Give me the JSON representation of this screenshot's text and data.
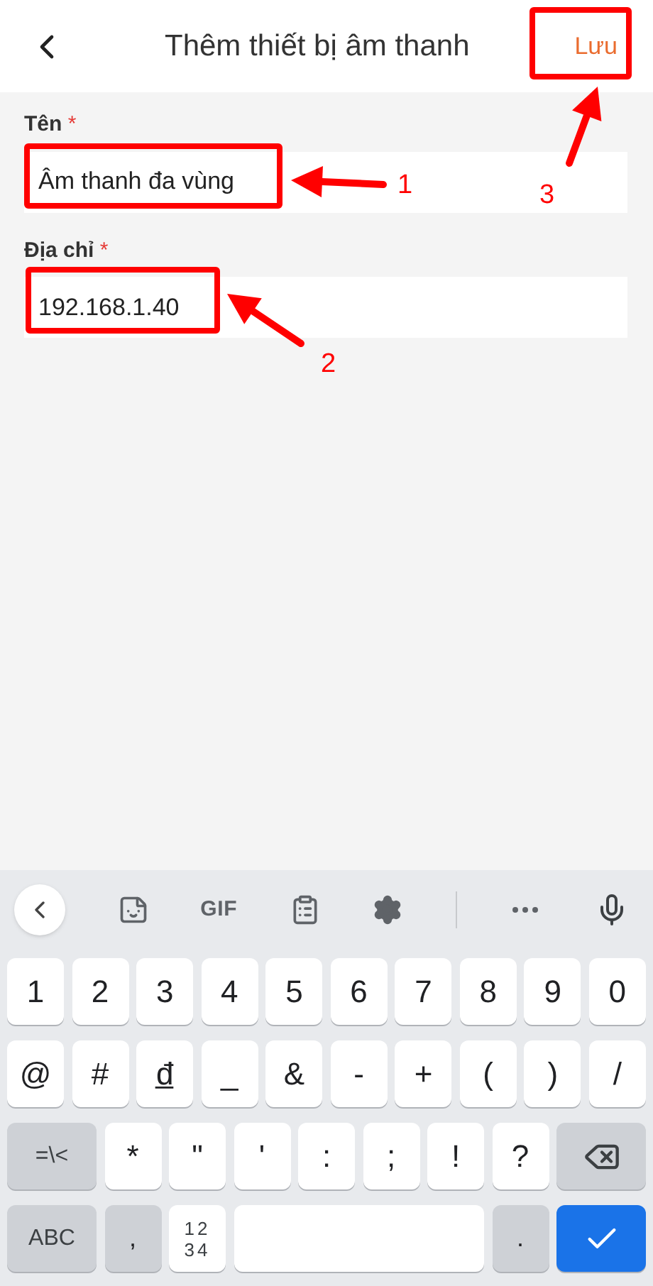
{
  "header": {
    "title": "Thêm thiết bị âm thanh",
    "action": "Lưu"
  },
  "fields": [
    {
      "label": "Tên",
      "required_mark": "*",
      "value": "Âm thanh đa vùng"
    },
    {
      "label": "Địa chỉ",
      "required_mark": "*",
      "value": "192.168.1.40"
    }
  ],
  "keyboard": {
    "toolbar": [
      {
        "kind": "back"
      },
      {
        "kind": "sticker"
      },
      {
        "kind": "text",
        "label": "GIF"
      },
      {
        "kind": "clipboard"
      },
      {
        "kind": "settings"
      },
      {
        "kind": "divider"
      },
      {
        "kind": "more"
      },
      {
        "kind": "mic"
      }
    ],
    "rows": [
      [
        {
          "kind": "char",
          "label": "1"
        },
        {
          "kind": "char",
          "label": "2"
        },
        {
          "kind": "char",
          "label": "3"
        },
        {
          "kind": "char",
          "label": "4"
        },
        {
          "kind": "char",
          "label": "5"
        },
        {
          "kind": "char",
          "label": "6"
        },
        {
          "kind": "char",
          "label": "7"
        },
        {
          "kind": "char",
          "label": "8"
        },
        {
          "kind": "char",
          "label": "9"
        },
        {
          "kind": "char",
          "label": "0"
        }
      ],
      [
        {
          "kind": "char",
          "label": "@"
        },
        {
          "kind": "char",
          "label": "#"
        },
        {
          "kind": "char",
          "label": "đ̲"
        },
        {
          "kind": "char",
          "label": "_"
        },
        {
          "kind": "char",
          "label": "&"
        },
        {
          "kind": "char",
          "label": "-"
        },
        {
          "kind": "char",
          "label": "+"
        },
        {
          "kind": "char",
          "label": "("
        },
        {
          "kind": "char",
          "label": ")"
        },
        {
          "kind": "char",
          "label": "/"
        }
      ],
      [
        {
          "kind": "mode",
          "label": "=\\<"
        },
        {
          "kind": "char",
          "label": "*"
        },
        {
          "kind": "char",
          "label": "\""
        },
        {
          "kind": "char",
          "label": "'"
        },
        {
          "kind": "char",
          "label": ":"
        },
        {
          "kind": "char",
          "label": ";"
        },
        {
          "kind": "char",
          "label": "!"
        },
        {
          "kind": "char",
          "label": "?"
        },
        {
          "kind": "backspace"
        }
      ],
      [
        {
          "kind": "mode",
          "label": "ABC"
        },
        {
          "kind": "gray",
          "label": ","
        },
        {
          "kind": "numpad",
          "lines": [
            "12",
            "34"
          ]
        },
        {
          "kind": "space"
        },
        {
          "kind": "gray",
          "label": "."
        },
        {
          "kind": "enter"
        }
      ]
    ]
  },
  "annotations": [
    {
      "label": "1"
    },
    {
      "label": "2"
    },
    {
      "label": "3"
    }
  ]
}
